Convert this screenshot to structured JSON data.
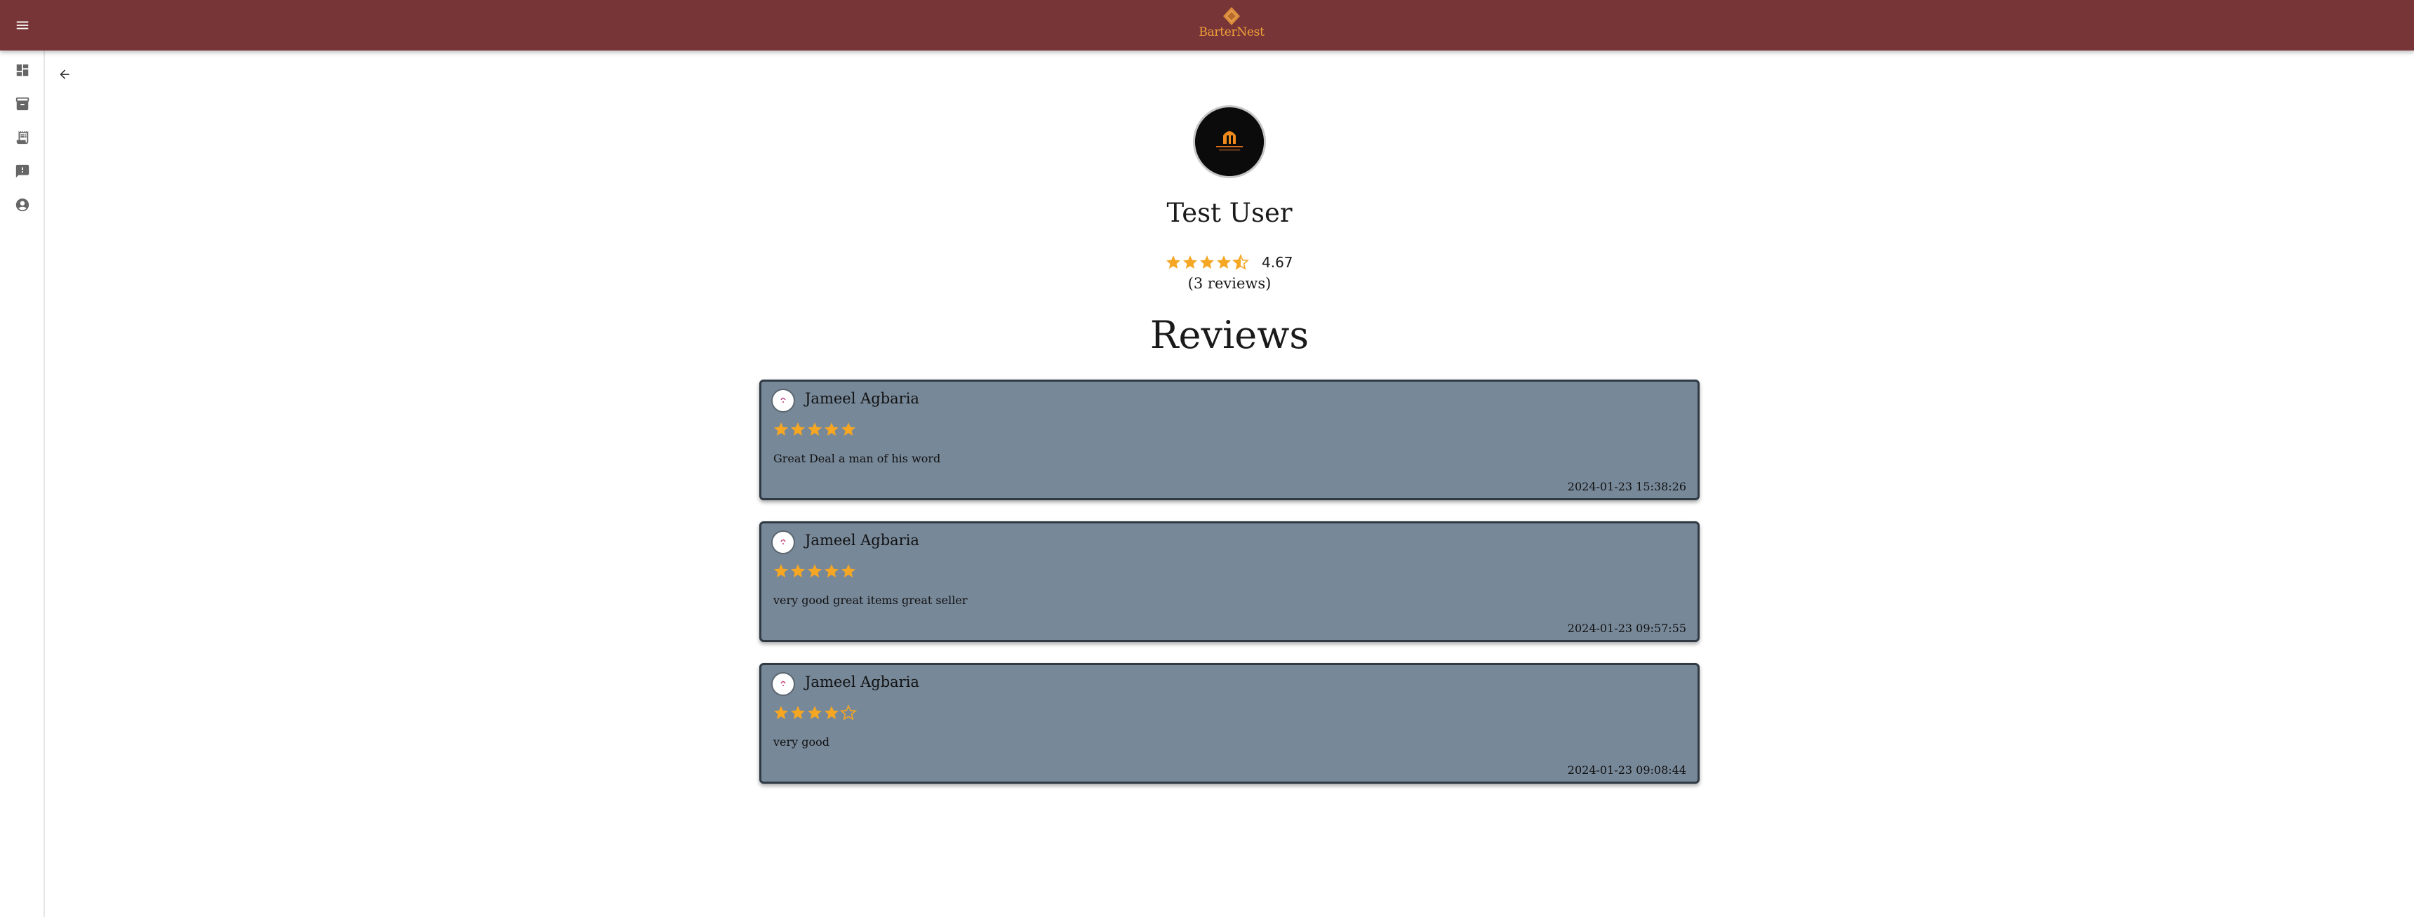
{
  "app": {
    "brand_name": "BarterNest",
    "accent_color": "#773537",
    "brand_text_color": "#f2a13a"
  },
  "topbar": {
    "menu_icon": "menu-icon"
  },
  "sidebar": {
    "items": [
      {
        "icon": "dashboard-icon"
      },
      {
        "icon": "inventory-icon"
      },
      {
        "icon": "receipt-icon"
      },
      {
        "icon": "feedback-icon"
      },
      {
        "icon": "account-circle-icon"
      }
    ]
  },
  "navigation": {
    "back_icon": "arrow-back-icon"
  },
  "profile": {
    "name": "Test User",
    "rating": 4.67,
    "rating_value": "4.67",
    "review_count_text": "(3 reviews)",
    "star_color": "#f5a623"
  },
  "reviews_section": {
    "heading": "Reviews",
    "card_color": "#778899",
    "items": [
      {
        "author": "Jameel Agbaria",
        "stars": 5,
        "text": "Great Deal a man of his word",
        "date": "2024-01-23 15:38:26"
      },
      {
        "author": "Jameel Agbaria",
        "stars": 5,
        "text": "very good great items great seller",
        "date": "2024-01-23 09:57:55"
      },
      {
        "author": "Jameel Agbaria",
        "stars": 4,
        "text": "very good",
        "date": "2024-01-23 09:08:44"
      }
    ]
  }
}
